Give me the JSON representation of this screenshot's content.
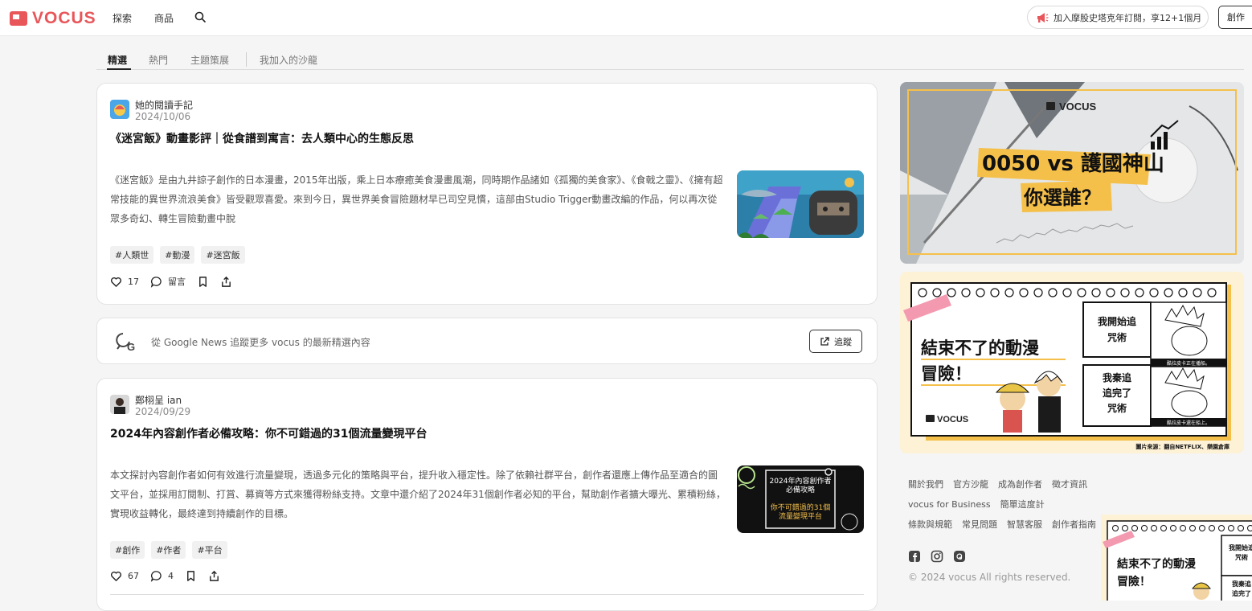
{
  "header": {
    "logo_text": "VOCUS",
    "nav": [
      "探索",
      "商品"
    ],
    "promo_text": "加入摩股史塔克年訂閱，享12+1個月",
    "create_label": "創作"
  },
  "tabs": [
    {
      "label": "精選",
      "active": true
    },
    {
      "label": "熱門",
      "active": false
    },
    {
      "label": "主題策展",
      "active": false
    },
    {
      "label": "我加入的沙龍",
      "active": false
    }
  ],
  "posts": [
    {
      "author": "她的閱讀手記",
      "date": "2024/10/06",
      "title": "《迷宮飯》動畫影評｜從食譜到寓言：去人類中心的生態反思",
      "excerpt": "《迷宮飯》是由九井諒子創作的日本漫畫，2015年出版，乘上日本療癒美食漫畫風潮，同時期作品諸如《孤獨的美食家》、《食戟之靈》、《擁有超常技能的異世界流浪美食》皆受觀眾喜愛。來到今日，異世界美食冒險題材早已司空見慣，這部由Studio Trigger動畫改編的作品，何以再次從眾多奇幻、轉生冒險動畫中脫",
      "tags": [
        "#人類世",
        "#動漫",
        "#迷宮飯"
      ],
      "likes": "17",
      "comment_label": "留言"
    },
    {
      "author": "鄭栩呈 ian",
      "date": "2024/09/29",
      "title": "2024年內容創作者必備攻略：你不可錯過的31個流量變現平台",
      "excerpt": "本文探討內容創作者如何有效進行流量變現，透過多元化的策略與平台，提升收入穩定性。除了依賴社群平台，創作者還應上傳作品至適合的圖文平台，並採用訂閱制、打賞、募資等方式來獲得粉絲支持。文章中還介紹了2024年31個創作者必知的平台，幫助創作者擴大曝光、累積粉絲，實現收益轉化，最終達到持續創作的目標。",
      "tags": [
        "#創作",
        "#作者",
        "#平台"
      ],
      "likes": "67",
      "comments": "4",
      "thumb_line1": "2024年內容創作者",
      "thumb_line2": "必備攻略",
      "thumb_line3": "你不可錯過的31個",
      "thumb_line4": "流量變現平台"
    }
  ],
  "google_news": {
    "text": "從 Google News 追蹤更多 vocus 的最新精選內容",
    "button": "追蹤"
  },
  "ads": {
    "ad1": {
      "brand": "VOCUS",
      "line1": "0050 vs 護國神山",
      "line2": "你選誰？"
    },
    "ad2": {
      "brand": "VOCUS",
      "headline1": "結束不了的動漫",
      "headline2": "冒險！",
      "box1_1": "我開始追",
      "box1_2": "咒術",
      "caption1": "酷拉皮卡正在播船。",
      "box2_1": "我秦追",
      "box2_2": "追完了",
      "box2_3": "咒術",
      "caption2": "酷拉皮卡還在船上。",
      "source": "圖片來源：翻自NETFLIX、樂園倉庫"
    },
    "ad3": {
      "headline1": "結束不了的動漫",
      "headline2": "冒險！",
      "box1": "我開始追",
      "box1b": "咒術",
      "box2": "我秦追",
      "box2b": "追完了"
    }
  },
  "footer": {
    "row1": [
      "關於我們",
      "官方沙龍",
      "成為創作者",
      "徵才資訊"
    ],
    "row2": [
      "vocus for Business",
      "簡單這度計"
    ],
    "row3": [
      "條款與規範",
      "常見問題",
      "智慧客服",
      "創作者指南"
    ],
    "copyright": "© 2024 vocus All rights reserved."
  },
  "colors": {
    "brand": "#e8565a",
    "ad_yellow": "#f5c04a",
    "accent_green": "#7ed957"
  }
}
